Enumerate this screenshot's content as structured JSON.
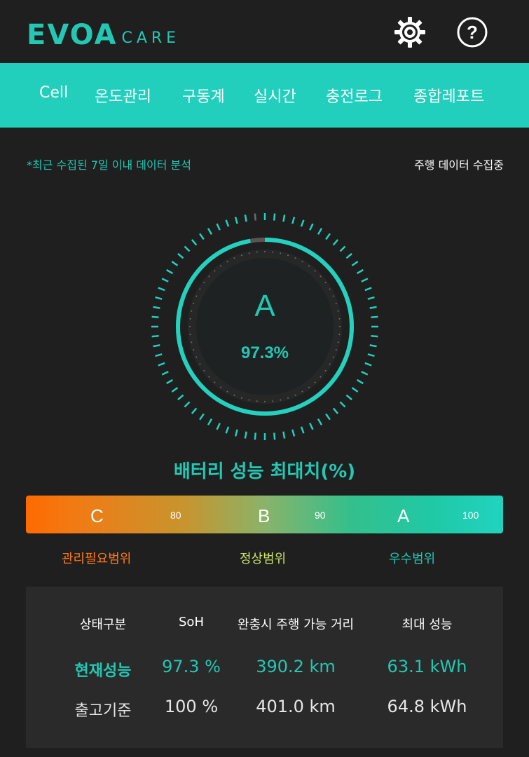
{
  "header": {
    "logo_main": "EVOA",
    "logo_sub": "CARE",
    "settings_icon": "gear-icon",
    "help_icon": "help-icon"
  },
  "nav": {
    "items": [
      "Cell",
      "온도관리",
      "구동계",
      "실시간",
      "충전로그",
      "종합레포트"
    ]
  },
  "notes": {
    "left": "*최근 수집된 7일 이내 데이터 분석",
    "right": "주행 데이터 수집중"
  },
  "gauge": {
    "grade": "A",
    "percent_label": "97.3%",
    "value_percent": 97.3,
    "caption": "배터리 성능 최대치(%)"
  },
  "scale": {
    "grades": [
      "C",
      "B",
      "A"
    ],
    "thresholds": [
      "80",
      "90",
      "100"
    ],
    "ranges": [
      {
        "label": "관리필요범위",
        "color": "#ff7a1a"
      },
      {
        "label": "정상범위",
        "color": "#c8e26a"
      },
      {
        "label": "우수범위",
        "color": "#23c7b3"
      }
    ]
  },
  "table": {
    "headers": [
      "상태구분",
      "SoH",
      "완충시 주행 가능 거리",
      "최대 성능"
    ],
    "rows": [
      [
        "현재성능",
        "97.3 %",
        "390.2 km",
        "63.1 kWh"
      ],
      [
        "출고기준",
        "100 %",
        "401.0 km",
        "64.8 kWh"
      ]
    ]
  },
  "colors": {
    "accent": "#23c7b3",
    "nav_bg": "#22cfbc",
    "background": "#1f1f1f",
    "panel": "#2a2a2a"
  }
}
